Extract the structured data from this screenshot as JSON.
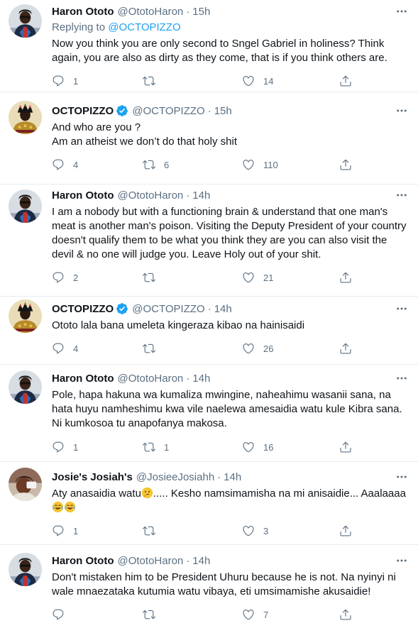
{
  "tweets": [
    {
      "name": "Haron Ototo",
      "handle": "@OtotoHaron",
      "time": "15h",
      "verified": false,
      "replying_label": "Replying to",
      "replying_to": "@OCTOPIZZO",
      "text": "Now you think you are only second to Sngel Gabriel in holiness? Think again, you are also as dirty as they come, that is if you think others are.",
      "replies": "1",
      "retweets": "",
      "likes": "14"
    },
    {
      "name": "OCTOPIZZO",
      "handle": "@OCTOPIZZO",
      "time": "15h",
      "verified": true,
      "text_lines": [
        "And who are you ?",
        "Am an atheist we don’t do that holy shit"
      ],
      "replies": "4",
      "retweets": "6",
      "likes": "110"
    },
    {
      "name": "Haron Ototo",
      "handle": "@OtotoHaron",
      "time": "14h",
      "verified": false,
      "text": "I am a nobody but with a functioning brain & understand that one man's meat is another man's poison. Visiting the Deputy President of your country doesn't qualify them to be what you think they are you can also visit the devil & no one will judge you. Leave Holy out of your shit.",
      "replies": "2",
      "retweets": "",
      "likes": "21"
    },
    {
      "name": "OCTOPIZZO",
      "handle": "@OCTOPIZZO",
      "time": "14h",
      "verified": true,
      "text": "Ototo lala bana umeleta kingeraza kibao na hainisaidi",
      "replies": "4",
      "retweets": "",
      "likes": "26"
    },
    {
      "name": "Haron Ototo",
      "handle": "@OtotoHaron",
      "time": "14h",
      "verified": false,
      "text": "Pole, hapa hakuna wa kumaliza mwingine, naheahimu wasanii sana, na hata huyu namheshimu kwa vile naelewa amesaidia watu kule Kibra sana. Ni kumkosoa tu anapofanya makosa.",
      "replies": "1",
      "retweets": "1",
      "likes": "16"
    },
    {
      "name": "Josie's Josiah's",
      "handle": "@JosieeJosiahh",
      "time": "14h",
      "verified": false,
      "text_before_emoji": "Aty anasaidia watu",
      "text_after_emoji": "..... Kesho namsimamisha na mi anisaidie... Aaalaaaa",
      "replies": "1",
      "retweets": "",
      "likes": "3"
    },
    {
      "name": "Haron Ototo",
      "handle": "@OtotoHaron",
      "time": "14h",
      "verified": false,
      "text": "Don't mistaken him to be President Uhuru because he is not. Na nyinyi ni wale mnaezataka kutumia watu vibaya, eti umsimamishe akusaidie!",
      "replies": "",
      "retweets": "",
      "likes": "7"
    }
  ],
  "colors": {
    "text": "#0f1419",
    "secondary": "#5b7083",
    "link": "#1da1f2",
    "divider": "#e6ecf0",
    "verified": "#1da1f2"
  },
  "icons": [
    "reply-icon",
    "retweet-icon",
    "like-icon",
    "share-icon",
    "more-icon",
    "verified-badge-icon",
    "thinking-face-emoji",
    "tears-of-joy-emoji"
  ]
}
